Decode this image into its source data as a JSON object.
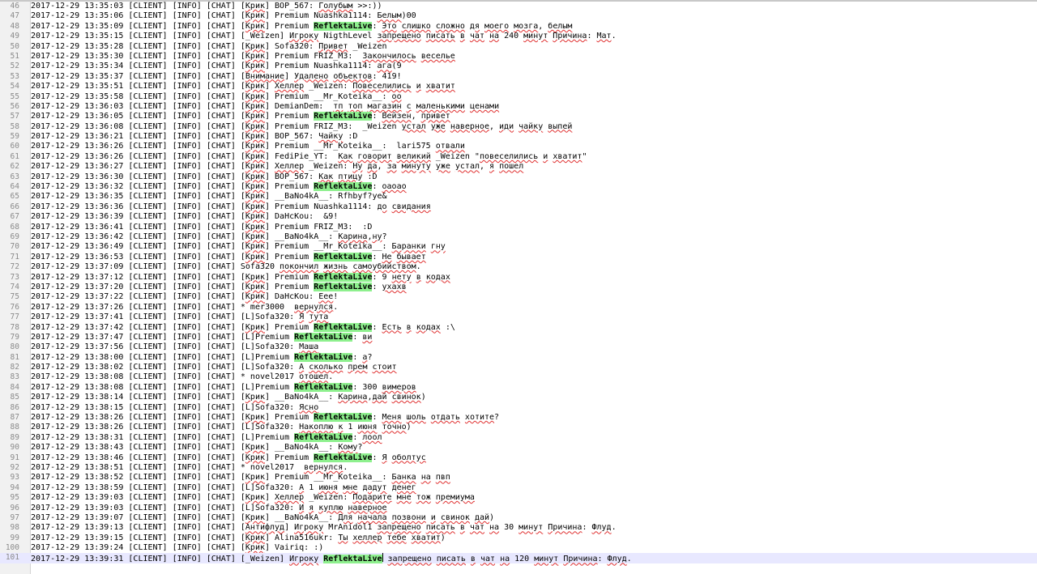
{
  "colors": {
    "highlight": "#8ef08e",
    "current_line": "#e8e8ff",
    "spellcheck": "#e03030",
    "gutter_bg": "#f1f1f1"
  },
  "current_line_number": 101,
  "caret_after": "ReflektaLive",
  "lines": [
    {
      "n": "46",
      "t": "2017-12-29 13:35:03 [CLIENT] [INFO] [CHAT] [Крик] BOP_567: Голубым >>:))"
    },
    {
      "n": "47",
      "t": "2017-12-29 13:35:06 [CLIENT] [INFO] [CHAT] [Крик] Premium Nuashka1114: Белым)00"
    },
    {
      "n": "48",
      "t": "2017-12-29 13:35:09 [CLIENT] [INFO] [CHAT] [Крик] Premium ReflektaLive: Это слишко сложно дя моего мозга, белым"
    },
    {
      "n": "49",
      "t": "2017-12-29 13:35:15 [CLIENT] [INFO] [CHAT] [_Weizen] Игроку NigthLevel запрещено писать в чат на 240 минут Причина: Мат."
    },
    {
      "n": "50",
      "t": "2017-12-29 13:35:28 [CLIENT] [INFO] [CHAT] [Крик] Sofa320: Привет _Weizen"
    },
    {
      "n": "51",
      "t": "2017-12-29 13:35:30 [CLIENT] [INFO] [CHAT] [Крик] Premium FRIZ_M3:  Закончилось веселье"
    },
    {
      "n": "52",
      "t": "2017-12-29 13:35:34 [CLIENT] [INFO] [CHAT] [Крик] Premium Nuashka1114: ага(9"
    },
    {
      "n": "53",
      "t": "2017-12-29 13:35:37 [CLIENT] [INFO] [CHAT] [Внимание] Удалено объектов: 419!"
    },
    {
      "n": "54",
      "t": "2017-12-29 13:35:51 [CLIENT] [INFO] [CHAT] [Крик] Хеллер _Weizen: Повеселились и хватит"
    },
    {
      "n": "55",
      "t": "2017-12-29 13:35:58 [CLIENT] [INFO] [CHAT] [Крик] Premium __Mr_Koteika__: оо"
    },
    {
      "n": "56",
      "t": "2017-12-29 13:36:03 [CLIENT] [INFO] [CHAT] [Крик] DemianDem:  тп топ магазин с маленькими ценами"
    },
    {
      "n": "57",
      "t": "2017-12-29 13:36:05 [CLIENT] [INFO] [CHAT] [Крик] Premium ReflektaLive: Вейзен, привет"
    },
    {
      "n": "58",
      "t": "2017-12-29 13:36:08 [CLIENT] [INFO] [CHAT] [Крик] Premium FRIZ_M3:  _Weizen устал уже наверное, иди чайку выпей"
    },
    {
      "n": "59",
      "t": "2017-12-29 13:36:21 [CLIENT] [INFO] [CHAT] [Крик] BOP_567: Чайку :D"
    },
    {
      "n": "60",
      "t": "2017-12-29 13:36:26 [CLIENT] [INFO] [CHAT] [Крик] Premium __Mr_Koteika__:  lari575 отвали"
    },
    {
      "n": "61",
      "t": "2017-12-29 13:36:26 [CLIENT] [INFO] [CHAT] [Крик] FediPie_YT:  Как говорит великий _Weizen \"повеселились и хватит\""
    },
    {
      "n": "62",
      "t": "2017-12-29 13:36:27 [CLIENT] [INFO] [CHAT] [Крик] Хеллер _Weizen: Ну да, за минуту уже устал, я пошел"
    },
    {
      "n": "63",
      "t": "2017-12-29 13:36:30 [CLIENT] [INFO] [CHAT] [Крик] BOP_567: Как птицу :D"
    },
    {
      "n": "64",
      "t": "2017-12-29 13:36:32 [CLIENT] [INFO] [CHAT] [Крик] Premium ReflektaLive: оаоао"
    },
    {
      "n": "65",
      "t": "2017-12-29 13:36:35 [CLIENT] [INFO] [CHAT] [Крик] __BaNo4kA__: Rfhbyf?ye&"
    },
    {
      "n": "66",
      "t": "2017-12-29 13:36:36 [CLIENT] [INFO] [CHAT] [Крик] Premium Nuashka1114: до свидания"
    },
    {
      "n": "67",
      "t": "2017-12-29 13:36:39 [CLIENT] [INFO] [CHAT] [Крик] DaHcKou:  &9!"
    },
    {
      "n": "68",
      "t": "2017-12-29 13:36:41 [CLIENT] [INFO] [CHAT] [Крик] Premium FRIZ_M3:  :D"
    },
    {
      "n": "69",
      "t": "2017-12-29 13:36:42 [CLIENT] [INFO] [CHAT] [Крик] __BaNo4kA__: Карина,ну?"
    },
    {
      "n": "70",
      "t": "2017-12-29 13:36:49 [CLIENT] [INFO] [CHAT] [Крик] Premium __Mr_Koteika__: Баранки гну"
    },
    {
      "n": "71",
      "t": "2017-12-29 13:36:53 [CLIENT] [INFO] [CHAT] [Крик] Premium ReflektaLive: Не бывает"
    },
    {
      "n": "72",
      "t": "2017-12-29 13:37:09 [CLIENT] [INFO] [CHAT] Sofa320 покончил жизнь самоубийством."
    },
    {
      "n": "73",
      "t": "2017-12-29 13:37:12 [CLIENT] [INFO] [CHAT] [Крик] Premium ReflektaLive: 9 нету в кодах"
    },
    {
      "n": "74",
      "t": "2017-12-29 13:37:20 [CLIENT] [INFO] [CHAT] [Крик] Premium ReflektaLive: ухахв"
    },
    {
      "n": "75",
      "t": "2017-12-29 13:37:22 [CLIENT] [INFO] [CHAT] [Крик] DaHcKou: Еее!"
    },
    {
      "n": "76",
      "t": "2017-12-29 13:37:26 [CLIENT] [INFO] [CHAT] * mer3000  вернулся."
    },
    {
      "n": "77",
      "t": "2017-12-29 13:37:41 [CLIENT] [INFO] [CHAT] [L]Sofa320: Я тута"
    },
    {
      "n": "78",
      "t": "2017-12-29 13:37:42 [CLIENT] [INFO] [CHAT] [Крик] Premium ReflektaLive: Есть в кодах :\\"
    },
    {
      "n": "79",
      "t": "2017-12-29 13:37:47 [CLIENT] [INFO] [CHAT] [L]Premium ReflektaLive: ви"
    },
    {
      "n": "80",
      "t": "2017-12-29 13:37:56 [CLIENT] [INFO] [CHAT] [L]Sofa320: Маша"
    },
    {
      "n": "81",
      "t": "2017-12-29 13:38:00 [CLIENT] [INFO] [CHAT] [L]Premium ReflektaLive: а?"
    },
    {
      "n": "82",
      "t": "2017-12-29 13:38:02 [CLIENT] [INFO] [CHAT] [L]Sofa320: А сколько прем стоит"
    },
    {
      "n": "83",
      "t": "2017-12-29 13:38:08 [CLIENT] [INFO] [CHAT] * novel2017 отошел."
    },
    {
      "n": "84",
      "t": "2017-12-29 13:38:08 [CLIENT] [INFO] [CHAT] [L]Premium ReflektaLive: 300 вимеров"
    },
    {
      "n": "85",
      "t": "2017-12-29 13:38:14 [CLIENT] [INFO] [CHAT] [Крик] __BaNo4kA__: Карина,дай свинок)"
    },
    {
      "n": "86",
      "t": "2017-12-29 13:38:15 [CLIENT] [INFO] [CHAT] [L]Sofa320: Ясно"
    },
    {
      "n": "87",
      "t": "2017-12-29 13:38:26 [CLIENT] [INFO] [CHAT] [Крик] Premium ReflektaLive: Меня шоль отдать хотите?"
    },
    {
      "n": "88",
      "t": "2017-12-29 13:38:26 [CLIENT] [INFO] [CHAT] [L]Sofa320: Накоплю к 1 июня точно)"
    },
    {
      "n": "89",
      "t": "2017-12-29 13:38:31 [CLIENT] [INFO] [CHAT] [L]Premium ReflektaLive: лоол"
    },
    {
      "n": "90",
      "t": "2017-12-29 13:38:43 [CLIENT] [INFO] [CHAT] [Крик] __BaNo4kA__: Кому?"
    },
    {
      "n": "91",
      "t": "2017-12-29 13:38:46 [CLIENT] [INFO] [CHAT] [Крик] Premium ReflektaLive: Я оболтус"
    },
    {
      "n": "92",
      "t": "2017-12-29 13:38:51 [CLIENT] [INFO] [CHAT] * novel2017  вернулся."
    },
    {
      "n": "93",
      "t": "2017-12-29 13:38:52 [CLIENT] [INFO] [CHAT] [Крик] Premium __Mr_Koteika__: Банка на пвп"
    },
    {
      "n": "94",
      "t": "2017-12-29 13:38:59 [CLIENT] [INFO] [CHAT] [L]Sofa320: А 1 июня мне дадут денег"
    },
    {
      "n": "95",
      "t": "2017-12-29 13:39:03 [CLIENT] [INFO] [CHAT] [Крик] Хеллер _Weizen: Подарите мне тож премиума"
    },
    {
      "n": "96",
      "t": "2017-12-29 13:39:03 [CLIENT] [INFO] [CHAT] [L]Sofa320: И я куплю наверное"
    },
    {
      "n": "97",
      "t": "2017-12-29 13:39:07 [CLIENT] [INFO] [CHAT] [Крик] __BaNo4kA__: Для начала позвони и свинок дай)"
    },
    {
      "n": "98",
      "t": "2017-12-29 13:39:13 [CLIENT] [INFO] [CHAT] [Антифлуд] Игроку MrAnidol1 запрещено писать в чат на 30 минут Причина: Флуд."
    },
    {
      "n": "99",
      "t": "2017-12-29 13:39:15 [CLIENT] [INFO] [CHAT] [Крик] Alina516ukr: Ты хеллер тебе хватит)"
    },
    {
      "n": "100",
      "t": "2017-12-29 13:39:24 [CLIENT] [INFO] [CHAT] [Крик] Vairiq: :)"
    },
    {
      "n": "101",
      "t": "2017-12-29 13:39:31 [CLIENT] [INFO] [CHAT] [_Weizen] Игроку ReflektaLive запрещено писать в чат на 120 минут Причина: Флуд."
    }
  ]
}
